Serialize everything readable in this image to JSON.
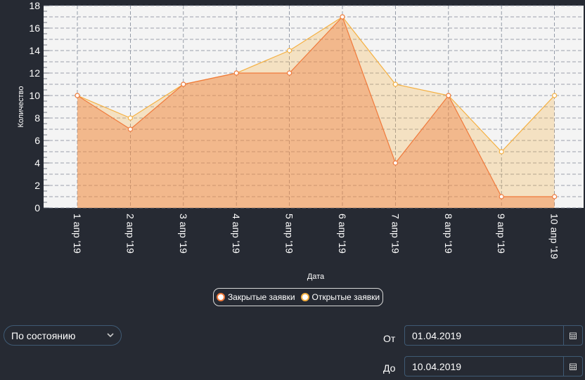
{
  "chart_data": {
    "type": "area",
    "categories": [
      "1 апр '19",
      "2 апр '19",
      "3 апр '19",
      "4 апр '19",
      "5 апр '19",
      "6 апр '19",
      "7 апр '19",
      "8 апр '19",
      "9 апр '19",
      "10 апр '19"
    ],
    "series": [
      {
        "name": "Закрытые заявки",
        "values": [
          10,
          7,
          11,
          12,
          12,
          17,
          4,
          10,
          1,
          1
        ],
        "color": "#f07a3c"
      },
      {
        "name": "Открытые заявки",
        "values": [
          10,
          8,
          11,
          12,
          14,
          17,
          11,
          10,
          5,
          10
        ],
        "color": "#f5b041"
      }
    ],
    "xlabel": "Дата",
    "ylabel": "Количество",
    "ylim": [
      0,
      18
    ],
    "yticks": [
      "0",
      "2",
      "4",
      "6",
      "8",
      "10",
      "12",
      "14",
      "16",
      "18"
    ],
    "grid": true,
    "legend_position": "bottom-center"
  },
  "filter": {
    "value": "По состоянию",
    "icon": "chevron-down-icon"
  },
  "date_from": {
    "label": "От",
    "value": "01.04.2019",
    "icon": "calendar-icon"
  },
  "date_to": {
    "label": "До",
    "value": "10.04.2019",
    "icon": "calendar-icon"
  },
  "colors": {
    "background": "#262a33",
    "plot_bg": "#f4f4f4",
    "field_border": "#3f5a74"
  }
}
